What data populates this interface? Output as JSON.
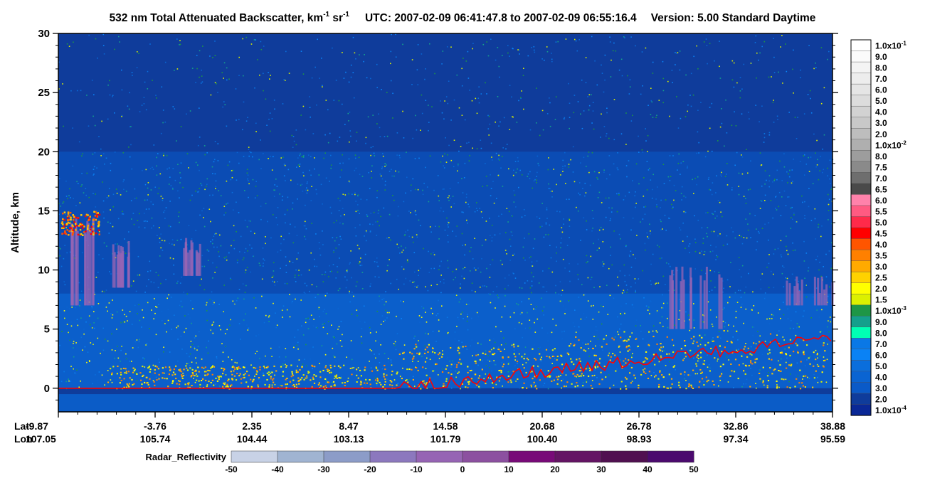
{
  "title": {
    "prefix": "532 nm Total Attenuated Backscatter, km",
    "exp1": "-1",
    "mid": " sr",
    "exp2": "-1",
    "utc": "UTC:  2007-02-09 06:41:47.8  to  2007-02-09 06:55:16.4",
    "version": "Version: 5.00  Standard  Daytime"
  },
  "chart_data": {
    "type": "heatmap",
    "ylabel": "Altitude, km",
    "ylim": [
      -2,
      30
    ],
    "y_ticks": [
      "0",
      "5",
      "10",
      "15",
      "20",
      "25",
      "30"
    ],
    "y_tick_values": [
      0,
      5,
      10,
      15,
      20,
      25,
      30
    ],
    "x_axis": {
      "lat_label": "Lat",
      "lon_label": "Lon",
      "lat": [
        "-9.87",
        "-3.76",
        "2.35",
        "8.47",
        "14.58",
        "20.68",
        "26.78",
        "32.86",
        "38.88"
      ],
      "lon": [
        "107.05",
        "105.74",
        "104.44",
        "103.13",
        "101.79",
        "100.40",
        "98.93",
        "97.34",
        "95.59"
      ]
    },
    "colorbar": [
      {
        "label": "1.0x10",
        "exp": "-1",
        "color": "#ffffff"
      },
      {
        "label": "9.0",
        "color": "#fbfbfb"
      },
      {
        "label": "8.0",
        "color": "#f4f4f4"
      },
      {
        "label": "7.0",
        "color": "#ededed"
      },
      {
        "label": "6.0",
        "color": "#e5e5e5"
      },
      {
        "label": "5.0",
        "color": "#dcdcdc"
      },
      {
        "label": "4.0",
        "color": "#d2d2d2"
      },
      {
        "label": "3.0",
        "color": "#c8c8c8"
      },
      {
        "label": "2.0",
        "color": "#bdbdbd"
      },
      {
        "label": "1.0x10",
        "exp": "-2",
        "color": "#afafaf"
      },
      {
        "label": "8.0",
        "color": "#9d9d9d"
      },
      {
        "label": "7.5",
        "color": "#8a8a8a"
      },
      {
        "label": "7.0",
        "color": "#6e6e6e"
      },
      {
        "label": "6.5",
        "color": "#4a4a4a"
      },
      {
        "label": "6.0",
        "color": "#ff82ab"
      },
      {
        "label": "5.5",
        "color": "#ff5a82"
      },
      {
        "label": "5.0",
        "color": "#ff2a4a"
      },
      {
        "label": "4.5",
        "color": "#ff0000"
      },
      {
        "label": "4.0",
        "color": "#ff5500"
      },
      {
        "label": "3.5",
        "color": "#ff8000"
      },
      {
        "label": "3.0",
        "color": "#ffaa00"
      },
      {
        "label": "2.5",
        "color": "#ffd200"
      },
      {
        "label": "2.0",
        "color": "#ffff00"
      },
      {
        "label": "1.5",
        "color": "#dcf000"
      },
      {
        "label": "1.0x10",
        "exp": "-3",
        "color": "#1e9646"
      },
      {
        "label": "9.0",
        "color": "#14a08c"
      },
      {
        "label": "8.0",
        "color": "#00ffb4"
      },
      {
        "label": "7.0",
        "color": "#0a78e6"
      },
      {
        "label": "6.0",
        "color": "#0a82f5"
      },
      {
        "label": "5.0",
        "color": "#0a6edc"
      },
      {
        "label": "4.0",
        "color": "#0a64d2"
      },
      {
        "label": "3.0",
        "color": "#0a5ac8"
      },
      {
        "label": "2.0",
        "color": "#0f3c9b"
      },
      {
        "label": "1.0x10",
        "exp": "-4",
        "color": "#0a2896"
      }
    ],
    "radar": {
      "label": "Radar_Reflectivity",
      "ticks": [
        "-50",
        "-40",
        "-30",
        "-20",
        "-10",
        "0",
        "10",
        "20",
        "30",
        "40",
        "50"
      ],
      "colors": [
        "#c8d2e6",
        "#a0b4d2",
        "#8c9cc8",
        "#8c78be",
        "#9664b4",
        "#8c50a0",
        "#780a78",
        "#641464",
        "#501050",
        "#4b0a6e",
        "#3c0a82"
      ]
    }
  }
}
